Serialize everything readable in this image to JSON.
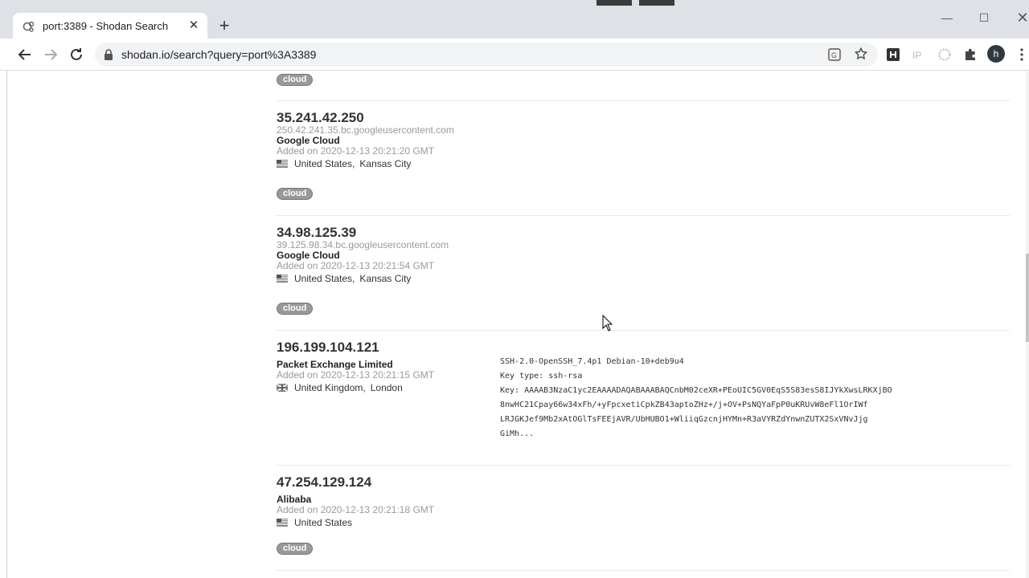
{
  "browser": {
    "tab_title": "port:3389 - Shodan Search",
    "url": "shodan.io/search?query=port%3A3389",
    "profile_initial": "h",
    "extensions": [
      "h-extension-icon",
      "ip-extension-icon",
      "circle-extension-icon",
      "puzzle-icon"
    ]
  },
  "top_tag": "cloud",
  "results": [
    {
      "ip": "35.241.42.250",
      "hostname": "250.42.241.35.bc.googleusercontent.com",
      "org": "Google Cloud",
      "added": "Added on 2020-12-13 20:21:20 GMT",
      "country": "United States",
      "city": "Kansas City",
      "flag": "us",
      "tag": "cloud"
    },
    {
      "ip": "34.98.125.39",
      "hostname": "39.125.98.34.bc.googleusercontent.com",
      "org": "Google Cloud",
      "added": "Added on 2020-12-13 20:21:54 GMT",
      "country": "United States",
      "city": "Kansas City",
      "flag": "us",
      "tag": "cloud"
    },
    {
      "ip": "196.199.104.121",
      "org": "Packet Exchange Limited",
      "added": "Added on 2020-12-13 20:21:15 GMT",
      "country": "United Kingdom",
      "city": "London",
      "flag": "uk",
      "banner": [
        "SSH-2.0-OpenSSH_7.4p1 Debian-10+deb9u4",
        "Key type: ssh-rsa",
        "Key: AAAAB3NzaC1yc2EAAAADAQABAAABAQCnbM02ceXR+PEoUIC5GV0EqS5S83esS8IJYkXwsLRKXjBO",
        "8nwHC21Cpay66w34xFh/+yFpcxetiCpkZB43aptoZHz+/j+OV+PsNQYaFpP0uKRUvW8eFl1OrIWf",
        "LRJGKJef9Mb2xAtOGlTsFEEjAVR/UbHUBO1+WliiqGzcnjHYMn+R3aVYRZdYnwnZUTX2SxVNvJjg",
        "GiMh..."
      ]
    },
    {
      "ip": "47.254.129.124",
      "org": "Alibaba",
      "added": "Added on 2020-12-13 20:21:18 GMT",
      "country": "United States",
      "flag": "us",
      "tag": "cloud"
    }
  ]
}
